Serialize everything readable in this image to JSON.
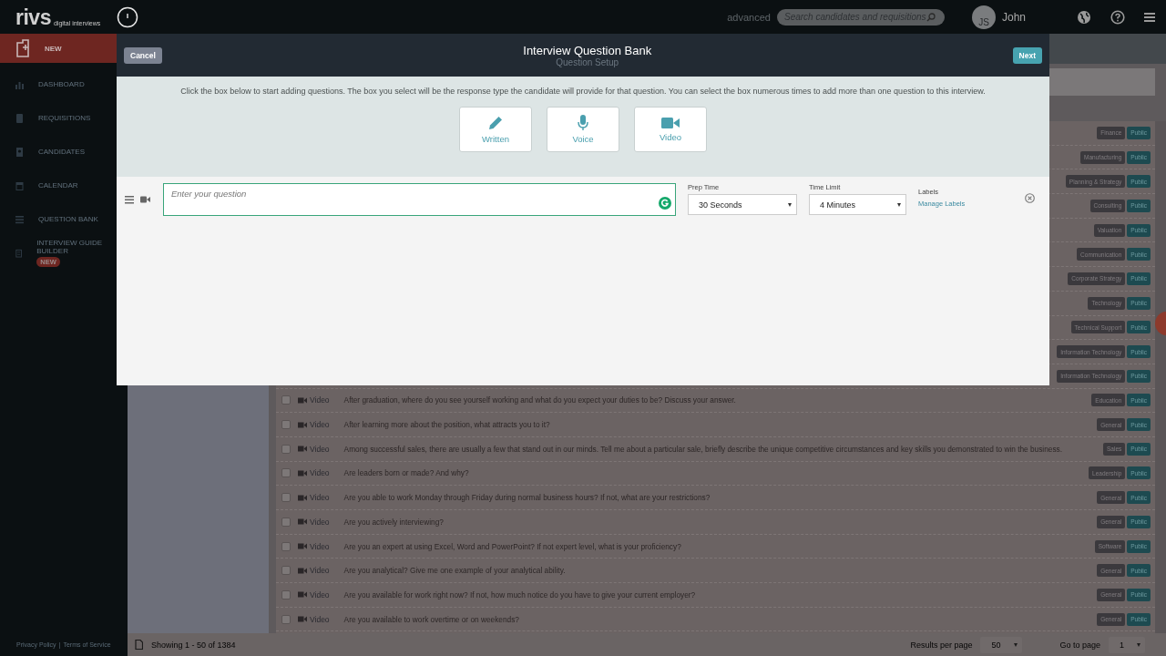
{
  "topbar": {
    "logo": "rivs",
    "logo_tagline": "digital interviews",
    "advanced_link": "advanced",
    "search": {
      "placeholder": "Search candidates and requisitions"
    },
    "avatar_initials": "JS",
    "user_name": "John"
  },
  "sidebar": {
    "items": [
      {
        "label": "NEW",
        "selected": true
      },
      {
        "label": "DASHBOARD",
        "selected": false
      },
      {
        "label": "REQUISITIONS",
        "selected": false
      },
      {
        "label": "CANDIDATES",
        "selected": false
      },
      {
        "label": "CALENDAR",
        "selected": false
      },
      {
        "label": "QUESTION BANK",
        "selected": false
      },
      {
        "label": "INTERVIEW GUIDE BUILDER",
        "selected": false,
        "badge": "NEW"
      }
    ],
    "footer_links": [
      "Privacy Policy",
      "Terms of Service"
    ],
    "footer_separator": "|"
  },
  "table": {
    "rows": [
      {
        "category": "Finance",
        "visibility": "Public"
      },
      {
        "category": "Manufacturing",
        "visibility": "Public"
      },
      {
        "category": "Planning & Strategy",
        "visibility": "Public"
      },
      {
        "category": "Consulting",
        "visibility": "Public"
      },
      {
        "category": "Valuation",
        "visibility": "Public"
      },
      {
        "category": "Communication",
        "visibility": "Public"
      },
      {
        "category": "Corporate Strategy",
        "visibility": "Public"
      },
      {
        "category": "Technology",
        "visibility": "Public"
      },
      {
        "category": "Technical Support",
        "visibility": "Public"
      },
      {
        "category": "Information Technology",
        "visibility": "Public"
      },
      {
        "category": "Information Technology",
        "visibility": "Public"
      },
      {
        "checked": false,
        "type": "Video",
        "question": "After graduation, where do you see yourself working and what do you expect your duties to be? Discuss your answer.",
        "category": "Education",
        "visibility": "Public"
      },
      {
        "checked": false,
        "type": "Video",
        "question": "After learning more about the position, what attracts you to it?",
        "category": "General",
        "visibility": "Public"
      },
      {
        "checked": false,
        "type": "Video",
        "question": "Among successful sales, there are usually a few that stand out in our minds. Tell me about a particular sale, briefly describe the unique competitive circumstances and key skills you demonstrated to win the business.",
        "category": "Sales",
        "visibility": "Public"
      },
      {
        "checked": false,
        "type": "Video",
        "question": "Are leaders born or made? And why?",
        "category": "Leadership",
        "visibility": "Public"
      },
      {
        "checked": false,
        "type": "Video",
        "question": "Are you able to work Monday through Friday during normal business hours? If not, what are your restrictions?",
        "category": "General",
        "visibility": "Public"
      },
      {
        "checked": false,
        "type": "Video",
        "question": "Are you actively interviewing?",
        "category": "General",
        "visibility": "Public"
      },
      {
        "checked": false,
        "type": "Video",
        "question": "Are you an expert at using Excel, Word and PowerPoint? If not expert level, what is your proficiency?",
        "category": "Software",
        "visibility": "Public"
      },
      {
        "checked": false,
        "type": "Video",
        "question": "Are you analytical? Give me one example of your analytical ability.",
        "category": "General",
        "visibility": "Public"
      },
      {
        "checked": false,
        "type": "Video",
        "question": "Are you available for work right now? If not, how much notice do you have to give your current employer?",
        "category": "General",
        "visibility": "Public"
      },
      {
        "checked": false,
        "type": "Video",
        "question": "Are you available to work overtime or on weekends?",
        "category": "General",
        "visibility": "Public"
      }
    ]
  },
  "footer": {
    "showing": "Showing 1 - 50 of 1384",
    "results_label": "Results per page",
    "results_value": "50",
    "page_label": "Go to page",
    "page_value": "1"
  },
  "modal": {
    "cancel": "Cancel",
    "title": "Interview Question Bank",
    "subtitle": "Question Setup",
    "next": "Next",
    "instructions": "Click the box below to start adding questions. The box you select will be the response type the candidate will provide for that question. You can select the box numerous times to add more than one question to this interview.",
    "response_types": [
      {
        "kind": "written",
        "label": "Written"
      },
      {
        "kind": "voice",
        "label": "Voice"
      },
      {
        "kind": "video",
        "label": "Video"
      }
    ],
    "question": {
      "placeholder": "Enter your question",
      "prep_label": "Prep Time",
      "prep_value": "30 Seconds",
      "limit_label": "Time Limit",
      "limit_value": "4 Minutes",
      "labels_label": "Labels",
      "manage_labels": "Manage Labels"
    }
  }
}
